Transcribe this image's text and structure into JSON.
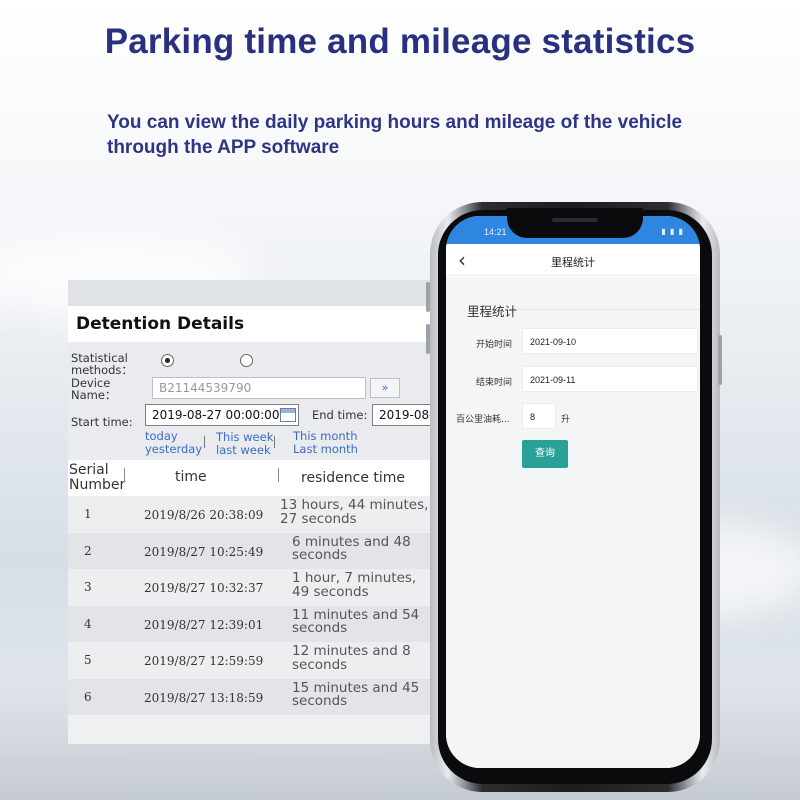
{
  "headline": "Parking time and mileage statistics",
  "subtitle": "You can view the daily parking hours and mileage of the vehicle through the APP software",
  "detention": {
    "title": "Detention Details",
    "statistical_methods_label": "Statistical methods：",
    "device_name_label": "Device Name：",
    "device_name_value": "B21144539790",
    "dropdown_icon": "»",
    "start_time_label": "Start time:",
    "start_time_value": "2019-08-27  00:00:00",
    "end_time_label": "End time:",
    "end_time_value": "2019-08-",
    "quick_links": {
      "today": "today",
      "yesterday": "yesterday",
      "this_week": "This week",
      "last_week": "last week",
      "this_month": "This month",
      "last_month": "Last month"
    },
    "columns": {
      "serial": "Serial Number",
      "time": "time",
      "residence": "residence time"
    },
    "rows": [
      {
        "serial": "1",
        "time": "2019/8/26 20:38:09",
        "residence": "13 hours, 44 minutes, 27 seconds"
      },
      {
        "serial": "2",
        "time": "2019/8/27 10:25:49",
        "residence": "6 minutes and 48 seconds"
      },
      {
        "serial": "3",
        "time": "2019/8/27 10:32:37",
        "residence": "1 hour, 7 minutes, 49 seconds"
      },
      {
        "serial": "4",
        "time": "2019/8/27 12:39:01",
        "residence": "11 minutes and 54 seconds"
      },
      {
        "serial": "5",
        "time": "2019/8/27 12:59:59",
        "residence": "12 minutes and 8 seconds"
      },
      {
        "serial": "6",
        "time": "2019/8/27 13:18:59",
        "residence": "15 minutes and 45 seconds"
      }
    ]
  },
  "phone": {
    "status_time": "14:21",
    "status_icons": "▮ ▮ ▮",
    "nav_back": "‹",
    "nav_title": "里程统计",
    "section_title": "里程统计",
    "start_label": "开始时间",
    "start_value": "2021-09-10",
    "end_label": "结束时间",
    "end_value": "2021-09-11",
    "fuel_label": "百公里油耗...",
    "fuel_value": "8",
    "fuel_unit": "升",
    "query_button": "查询",
    "accent_color": "#2f86e0",
    "button_color": "#2aa197"
  }
}
